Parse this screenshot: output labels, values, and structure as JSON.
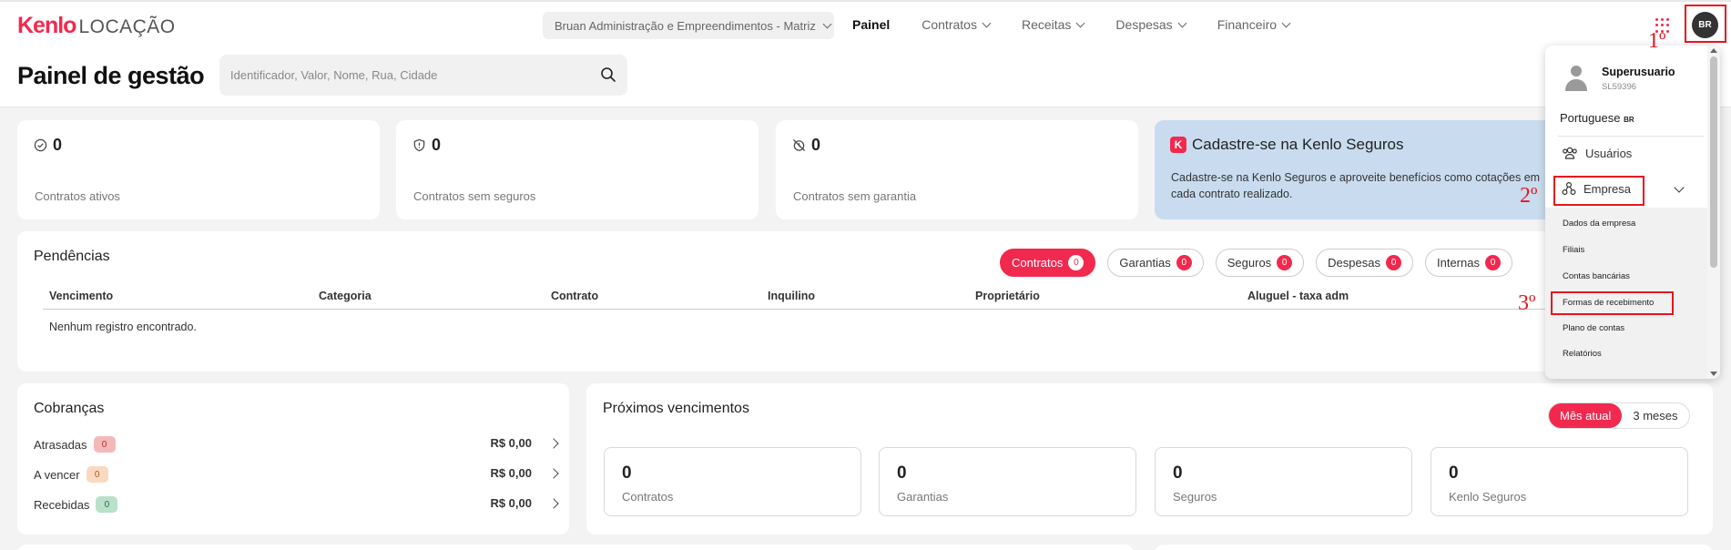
{
  "topbar": {
    "logo_brand": "Kenlo",
    "logo_suffix": "LOCAÇÃO",
    "company": "Bruan Administração e Empreendimentos - Matriz",
    "nav": [
      {
        "label": "Painel",
        "active": true
      },
      {
        "label": "Contratos"
      },
      {
        "label": "Receitas"
      },
      {
        "label": "Despesas"
      },
      {
        "label": "Financeiro"
      }
    ],
    "avatar": "BR"
  },
  "header": {
    "title": "Painel de gestão",
    "search_placeholder": "Identificador, Valor, Nome, Rua, Cidade"
  },
  "stats": [
    {
      "value": "0",
      "label": "Contratos ativos",
      "icon": "check-circle-icon"
    },
    {
      "value": "0",
      "label": "Contratos sem seguros",
      "icon": "shield-icon"
    },
    {
      "value": "0",
      "label": "Contratos sem garantia",
      "icon": "clock-off-icon"
    }
  ],
  "promo": {
    "title": "Cadastre-se na Kenlo Seguros",
    "text": "Cadastre-se na Kenlo Seguros e aproveite benefícios como cotações em cada contrato realizado."
  },
  "pendencias": {
    "title": "Pendências",
    "chips": [
      {
        "label": "Contratos",
        "count": "0",
        "active": true
      },
      {
        "label": "Garantias",
        "count": "0"
      },
      {
        "label": "Seguros",
        "count": "0"
      },
      {
        "label": "Despesas",
        "count": "0"
      },
      {
        "label": "Internas",
        "count": "0"
      }
    ],
    "columns": [
      "Vencimento",
      "Categoria",
      "Contrato",
      "Inquilino",
      "Proprietário",
      "Aluguel - taxa adm"
    ],
    "empty": "Nenhum registro encontrado."
  },
  "cobrancas": {
    "title": "Cobranças",
    "rows": [
      {
        "label": "Atrasadas",
        "count": "0",
        "value": "R$ 0,00"
      },
      {
        "label": "A vencer",
        "count": "0",
        "value": "R$ 0,00"
      },
      {
        "label": "Recebidas",
        "count": "0",
        "value": "R$ 0,00"
      }
    ]
  },
  "proximos": {
    "title": "Próximos vencimentos",
    "toggle": [
      "Mês atual",
      "3 meses"
    ],
    "cards": [
      {
        "value": "0",
        "label": "Contratos"
      },
      {
        "value": "0",
        "label": "Garantias"
      },
      {
        "value": "0",
        "label": "Seguros"
      },
      {
        "value": "0",
        "label": "Kenlo Seguros"
      }
    ]
  },
  "menu": {
    "user_name": "Superusuario",
    "user_code": "SL59396",
    "language": "Portuguese",
    "language_code": "BR",
    "usuarios": "Usuários",
    "empresa": "Empresa",
    "submenu": [
      "Dados da empresa",
      "Filiais",
      "Contas bancárias",
      "Formas de recebimento",
      "Plano de contas",
      "Relatórios"
    ]
  },
  "annotations": [
    "1º",
    "2º",
    "3º"
  ],
  "colors": {
    "accent": "#f2294e",
    "annotation": "#e8141f",
    "promo_bg": "#c9dcef"
  }
}
